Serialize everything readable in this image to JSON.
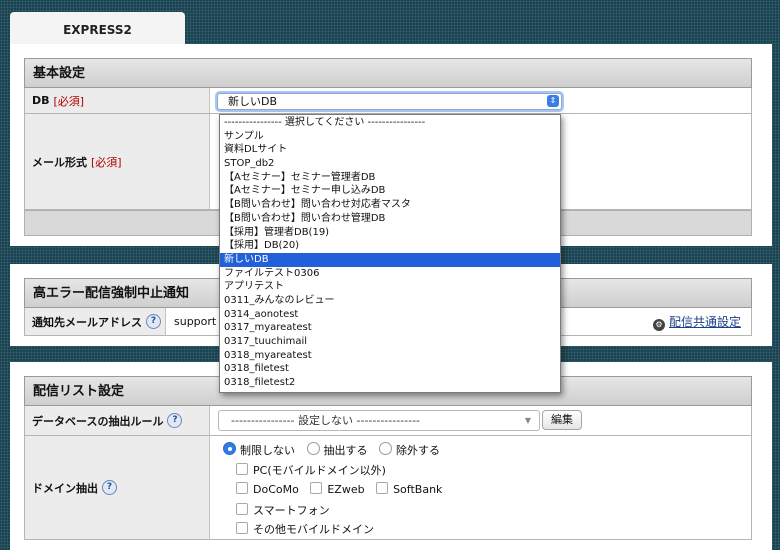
{
  "tab": {
    "title": "EXPRESS2"
  },
  "basic": {
    "header": "基本設定",
    "db_label": "DB",
    "required": "[必須]",
    "db_selected": "新しいDB",
    "mail_label": "メール形式",
    "options": [
      "---------------- 選択してください ----------------",
      "サンプル",
      "資料DLサイト",
      "STOP_db2",
      "【Aセミナー】セミナー管理者DB",
      "【Aセミナー】セミナー申し込みDB",
      "【B問い合わせ】問い合わせ対応者マスタ",
      "【B問い合わせ】問い合わせ管理DB",
      "【採用】管理者DB(19)",
      "【採用】DB(20)",
      "新しいDB",
      "ファイルテスト0306",
      "アプリテスト",
      "0311_みんなのレビュー",
      "0314_aonotest",
      "0317_myareatest",
      "0317_tuuchimail",
      "0318_myareatest",
      "0318_filetest",
      "0318_filetest2"
    ],
    "selected_index": 10
  },
  "alert": {
    "header": "高エラー配信強制中止通知",
    "email_label": "通知先メールアドレス",
    "email_value": "support",
    "link": "配信共通設定"
  },
  "delivery": {
    "header": "配信リスト設定",
    "rule_label": "データベースの抽出ルール",
    "rule_value": "---------------- 設定しない ----------------",
    "edit_button": "編集",
    "domain_label": "ドメイン抽出",
    "radio_none": "制限しない",
    "radio_extract": "抽出する",
    "radio_exclude": "除外する",
    "cb_pc": "PC(モバイルドメイン以外)",
    "cb_docomo": "DoCoMo",
    "cb_ezweb": "EZweb",
    "cb_softbank": "SoftBank",
    "cb_smartphone": "スマートフォン",
    "cb_other_mobile": "その他モバイルドメイン"
  }
}
